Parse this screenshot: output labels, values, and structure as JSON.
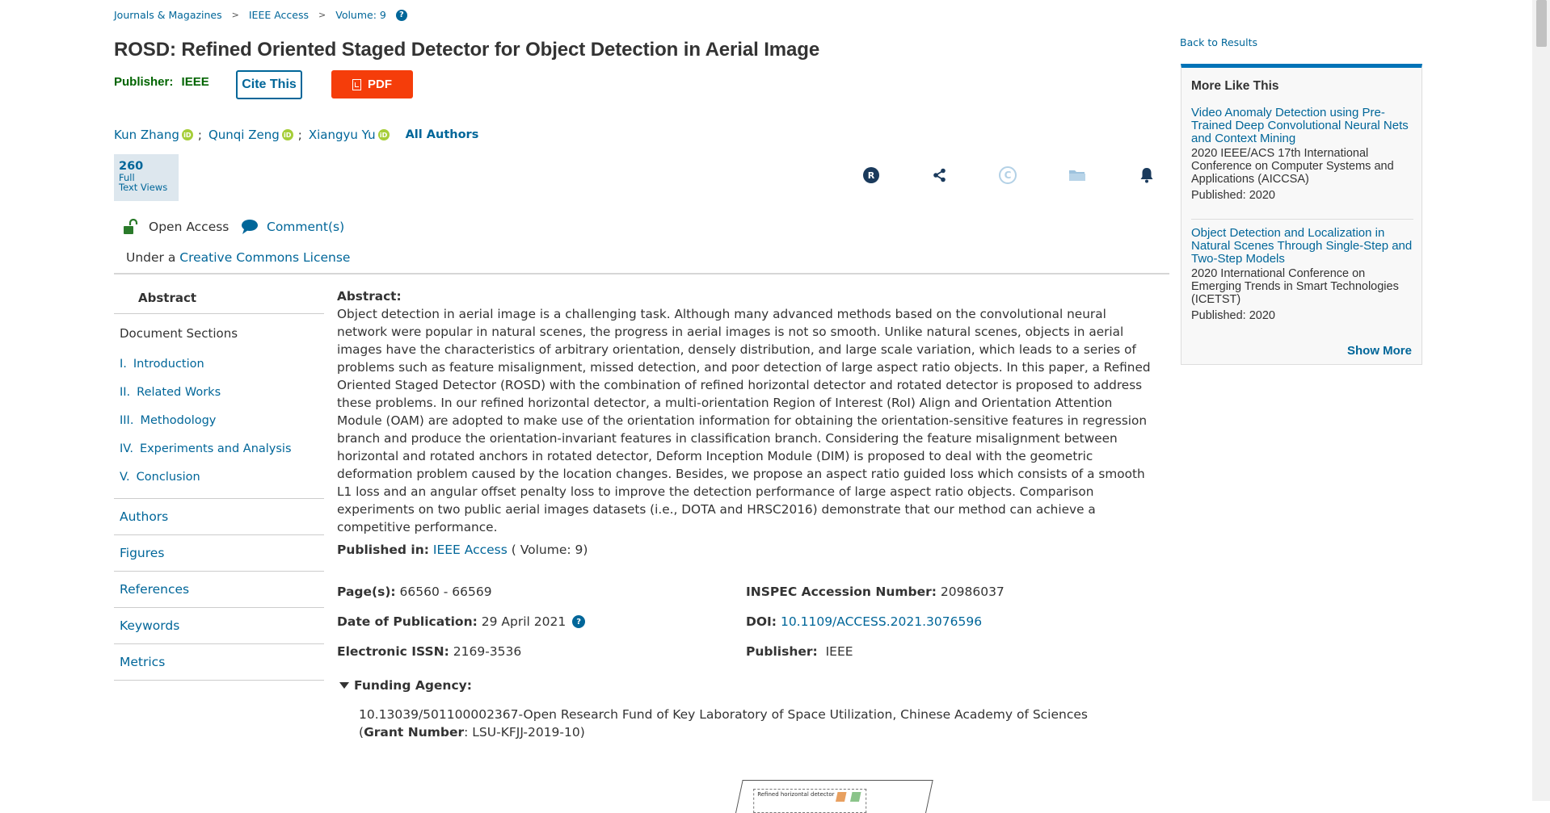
{
  "breadcrumb": {
    "items": [
      "Journals & Magazines",
      "IEEE Access",
      "Volume: 9"
    ],
    "separator": ">"
  },
  "article": {
    "title": "ROSD: Refined Oriented Staged Detector for Object Detection in Aerial Image",
    "publisher_label": "Publisher:",
    "publisher": "IEEE",
    "cite_label": "Cite This",
    "pdf_label": "PDF",
    "authors": [
      "Kun Zhang",
      "Qunqi Zeng",
      "Xiangyu Yu"
    ],
    "author_separator": ";",
    "all_authors_label": "All Authors",
    "views_count": "260",
    "views_label_1": "Full",
    "views_label_2": "Text Views",
    "open_access_label": "Open Access",
    "comments_label": "Comment(s)",
    "license_prefix": "Under a",
    "license_link": "Creative Commons License"
  },
  "tool_icons": [
    "rights-icon",
    "share-icon",
    "copyright-icon",
    "folder-icon",
    "alert-bell-icon"
  ],
  "nav": {
    "abstract": "Abstract",
    "doc_sections_label": "Document Sections",
    "sections": [
      {
        "num": "I.",
        "label": "Introduction"
      },
      {
        "num": "II.",
        "label": "Related Works"
      },
      {
        "num": "III.",
        "label": "Methodology"
      },
      {
        "num": "IV.",
        "label": "Experiments and Analysis"
      },
      {
        "num": "V.",
        "label": "Conclusion"
      }
    ],
    "groups": [
      "Authors",
      "Figures",
      "References",
      "Keywords",
      "Metrics"
    ]
  },
  "abstract": {
    "label": "Abstract:",
    "text": "Object detection in aerial image is a challenging task. Although many advanced methods based on the convolutional neural network were popular in natural scenes, the progress in aerial images is not so smooth. Unlike natural scenes, objects in aerial images have the characteristics of arbitrary orientation, densely distribution, and large scale variation, which leads to a series of problems such as feature misalignment, missed detection, and poor detection of large aspect ratio objects. In this paper, a Refined Oriented Staged Detector (ROSD) with the combination of refined horizontal detector and rotated detector is proposed to address these problems. In our refined horizontal detector, a multi-orientation Region of Interest (RoI) Align and Orientation Attention Module (OAM) are adopted to make use of the orientation information for obtaining the orientation-sensitive features in regression branch and produce the orientation-invariant features in classification branch. Considering the feature misalignment between horizontal and rotated anchors in rotated detector, Deform Inception Module (DIM) is proposed to deal with the geometric deformation problem caused by the location changes. Besides, we propose an aspect ratio guided loss which consists of a smooth L1 loss and an angular offset penalty loss to improve the detection performance of large aspect ratio objects. Comparison experiments on two public aerial images datasets (i.e., DOTA and HRSC2016) demonstrate that our method can achieve a competitive performance."
  },
  "published_in": {
    "label": "Published in:",
    "journal": "IEEE Access",
    "volume": "( Volume: 9)"
  },
  "metadata": {
    "pages_label": "Page(s):",
    "pages": "66560 - 66569",
    "date_label": "Date of Publication:",
    "date": "29 April 2021",
    "issn_label": "Electronic ISSN:",
    "issn": "2169-3536",
    "inspec_label": "INSPEC Accession Number:",
    "inspec": "20986037",
    "doi_label": "DOI:",
    "doi": "10.1109/ACCESS.2021.3076596",
    "publisher_label": "Publisher:",
    "publisher": "IEEE"
  },
  "funding": {
    "label": "Funding Agency:",
    "text": "10.13039/501100002367-Open Research Fund of Key Laboratory of Space Utilization, Chinese Academy of Sciences (",
    "grant_label": "Grant Number",
    "grant_value": ": LSU-KFJJ-2019-10)"
  },
  "figure_caption": "Refined horizontal detector",
  "sidebar": {
    "back_label": "Back to Results",
    "more_like_this_title": "More Like This",
    "items": [
      {
        "title": "Video Anomaly Detection using Pre-Trained Deep Convolutional Neural Nets and Context Mining",
        "conference": "2020 IEEE/ACS 17th International Conference on Computer Systems and Applications (AICCSA)",
        "published": "Published: 2020"
      },
      {
        "title": "Object Detection and Localization in Natural Scenes Through Single-Step and Two-Step Models",
        "conference": "2020 International Conference on Emerging Trends in Smart Technologies (ICETST)",
        "published": "Published: 2020"
      }
    ],
    "show_more_label": "Show More"
  },
  "colors": {
    "link": "#006699",
    "pdf": "#f53d0a",
    "publisher": "#006400",
    "accent_bar": "#0073b7"
  }
}
